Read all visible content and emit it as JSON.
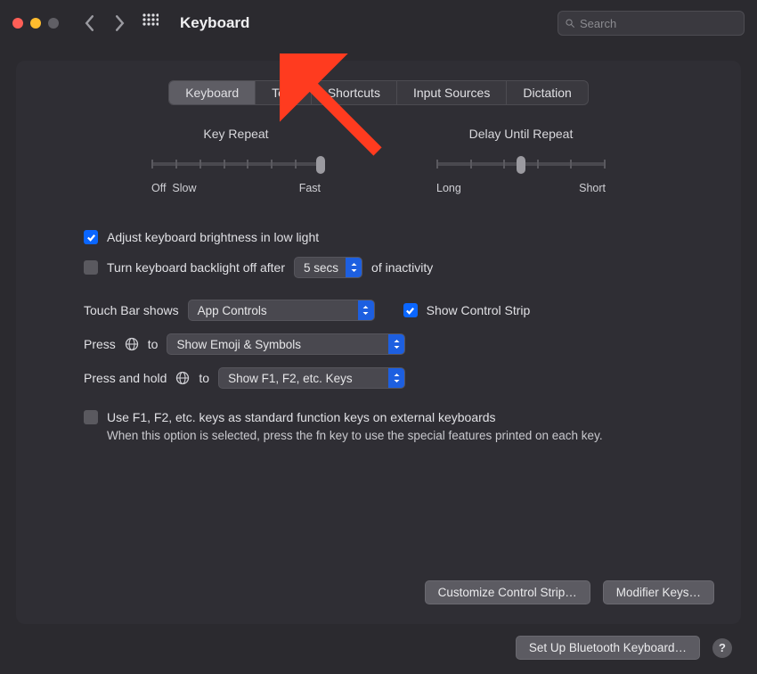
{
  "window": {
    "title": "Keyboard"
  },
  "search": {
    "placeholder": "Search"
  },
  "tabs": [
    "Keyboard",
    "Text",
    "Shortcuts",
    "Input Sources",
    "Dictation"
  ],
  "sliders": {
    "keyRepeat": {
      "title": "Key Repeat",
      "leftExtra": "Off",
      "leftLabel": "Slow",
      "rightLabel": "Fast",
      "value": 7,
      "max": 7
    },
    "delayRepeat": {
      "title": "Delay Until Repeat",
      "leftLabel": "Long",
      "rightLabel": "Short",
      "value": 3,
      "max": 5
    }
  },
  "options": {
    "adjustBrightness": {
      "label": "Adjust keyboard brightness in low light",
      "checked": true
    },
    "backlightOff": {
      "label_pre": "Turn keyboard backlight off after",
      "label_post": "of inactivity",
      "value": "5 secs",
      "checked": false
    },
    "touchBar": {
      "label": "Touch Bar shows",
      "value": "App Controls"
    },
    "controlStrip": {
      "label": "Show Control Strip",
      "checked": true
    },
    "pressGlobe": {
      "label_pre": "Press",
      "label_post": "to",
      "value": "Show Emoji & Symbols"
    },
    "holdGlobe": {
      "label_pre": "Press and hold",
      "label_post": "to",
      "value": "Show F1, F2, etc. Keys"
    },
    "fnKeys": {
      "label": "Use F1, F2, etc. keys as standard function keys on external keyboards",
      "checked": false,
      "hint": "When this option is selected, press the fn key to use the special features printed on each key."
    }
  },
  "buttons": {
    "customizeControlStrip": "Customize Control Strip…",
    "modifierKeys": "Modifier Keys…",
    "bluetoothKeyboard": "Set Up Bluetooth Keyboard…"
  }
}
